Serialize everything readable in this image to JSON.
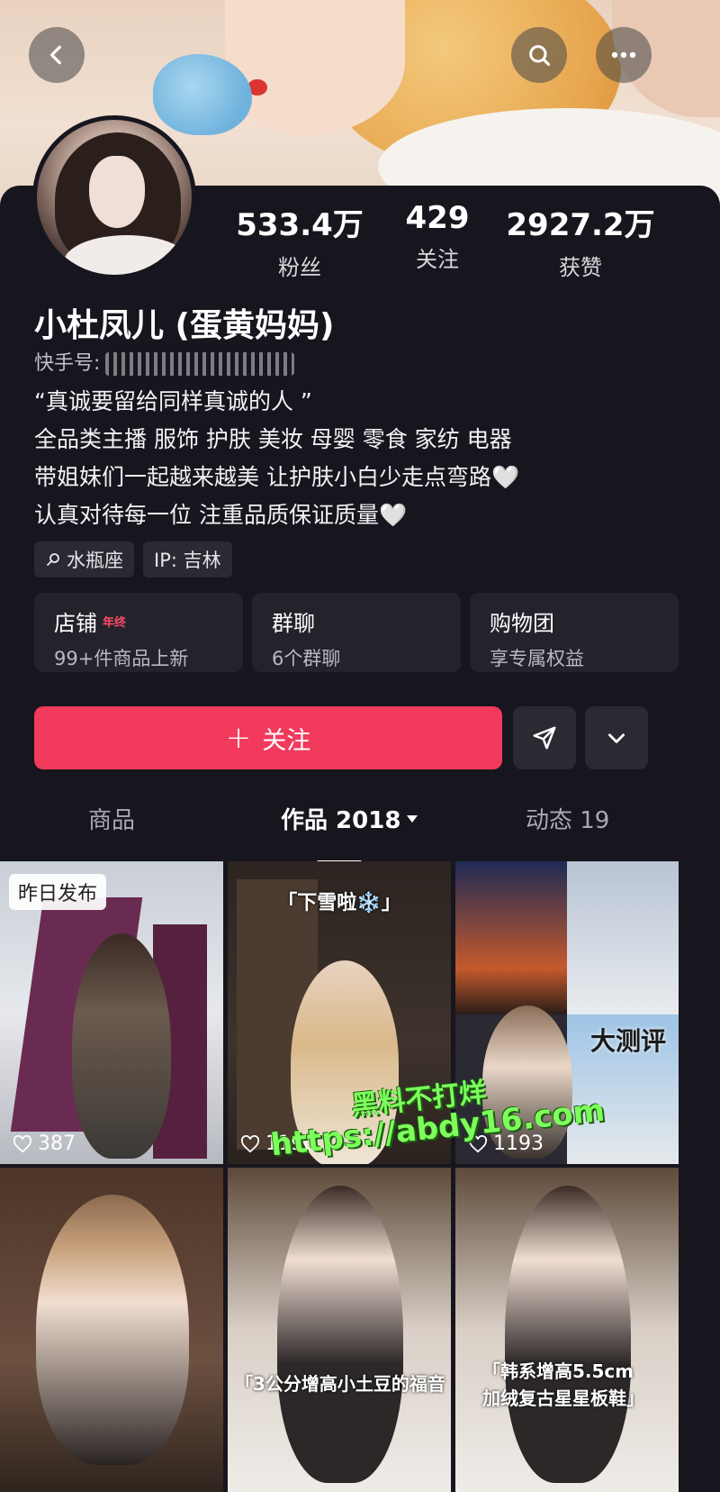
{
  "header": {
    "back_icon": "chevron-left-icon",
    "search_icon": "search-icon",
    "more_icon": "more-horizontal-icon"
  },
  "profile": {
    "stats": [
      {
        "value": "533.4万",
        "label": "粉丝"
      },
      {
        "value": "429",
        "label": "关注"
      },
      {
        "value": "2927.2万",
        "label": "获赞"
      }
    ],
    "name": "小杜凤儿 (蛋黄妈妈)",
    "account_label": "快手号:",
    "bio_lines": [
      "“真诚要留给同样真诚的人 ”",
      "全品类主播 服饰 护肤 美妆 母婴 零食 家纺 电器",
      "带姐妹们一起越来越美  让护肤小白少走点弯路🤍",
      "认真对待每一位 注重品质保证质量🤍"
    ],
    "tags": [
      "水瓶座",
      "IP: 吉林"
    ]
  },
  "shortcuts": [
    {
      "title": "店铺",
      "hot": "年终",
      "subtitle": "99+件商品上新"
    },
    {
      "title": "群聊",
      "hot": "",
      "subtitle": "6个群聊"
    },
    {
      "title": "购物团",
      "hot": "",
      "subtitle": "享专属权益"
    }
  ],
  "actions": {
    "follow_label": "关注",
    "follow_plus": "+",
    "share_icon": "send-icon",
    "dropdown_icon": "chevron-down-icon"
  },
  "tabs": [
    {
      "label": "商品"
    },
    {
      "label": "作品 2018"
    },
    {
      "label": "动态 19"
    }
  ],
  "videos": [
    {
      "badge": "昨日发布",
      "likes": "387",
      "caption": ""
    },
    {
      "badge": "",
      "likes": "1190",
      "caption": "「下雪啦❄️」"
    },
    {
      "badge": "",
      "likes": "1193",
      "caption": "大测评"
    },
    {
      "badge": "",
      "likes": "",
      "caption": ""
    },
    {
      "badge": "",
      "likes": "",
      "caption": "「3公分增高小土豆的福音"
    },
    {
      "badge": "",
      "likes": "",
      "caption": "「韩系增高5.5cm",
      "caption2": "加绒复古星星板鞋」"
    }
  ],
  "watermark": {
    "line1": "黑料不打烊",
    "line2": "https://abdy16.com"
  },
  "colors": {
    "accent": "#f13a5c",
    "background": "#17161e",
    "card": "#23232b"
  }
}
